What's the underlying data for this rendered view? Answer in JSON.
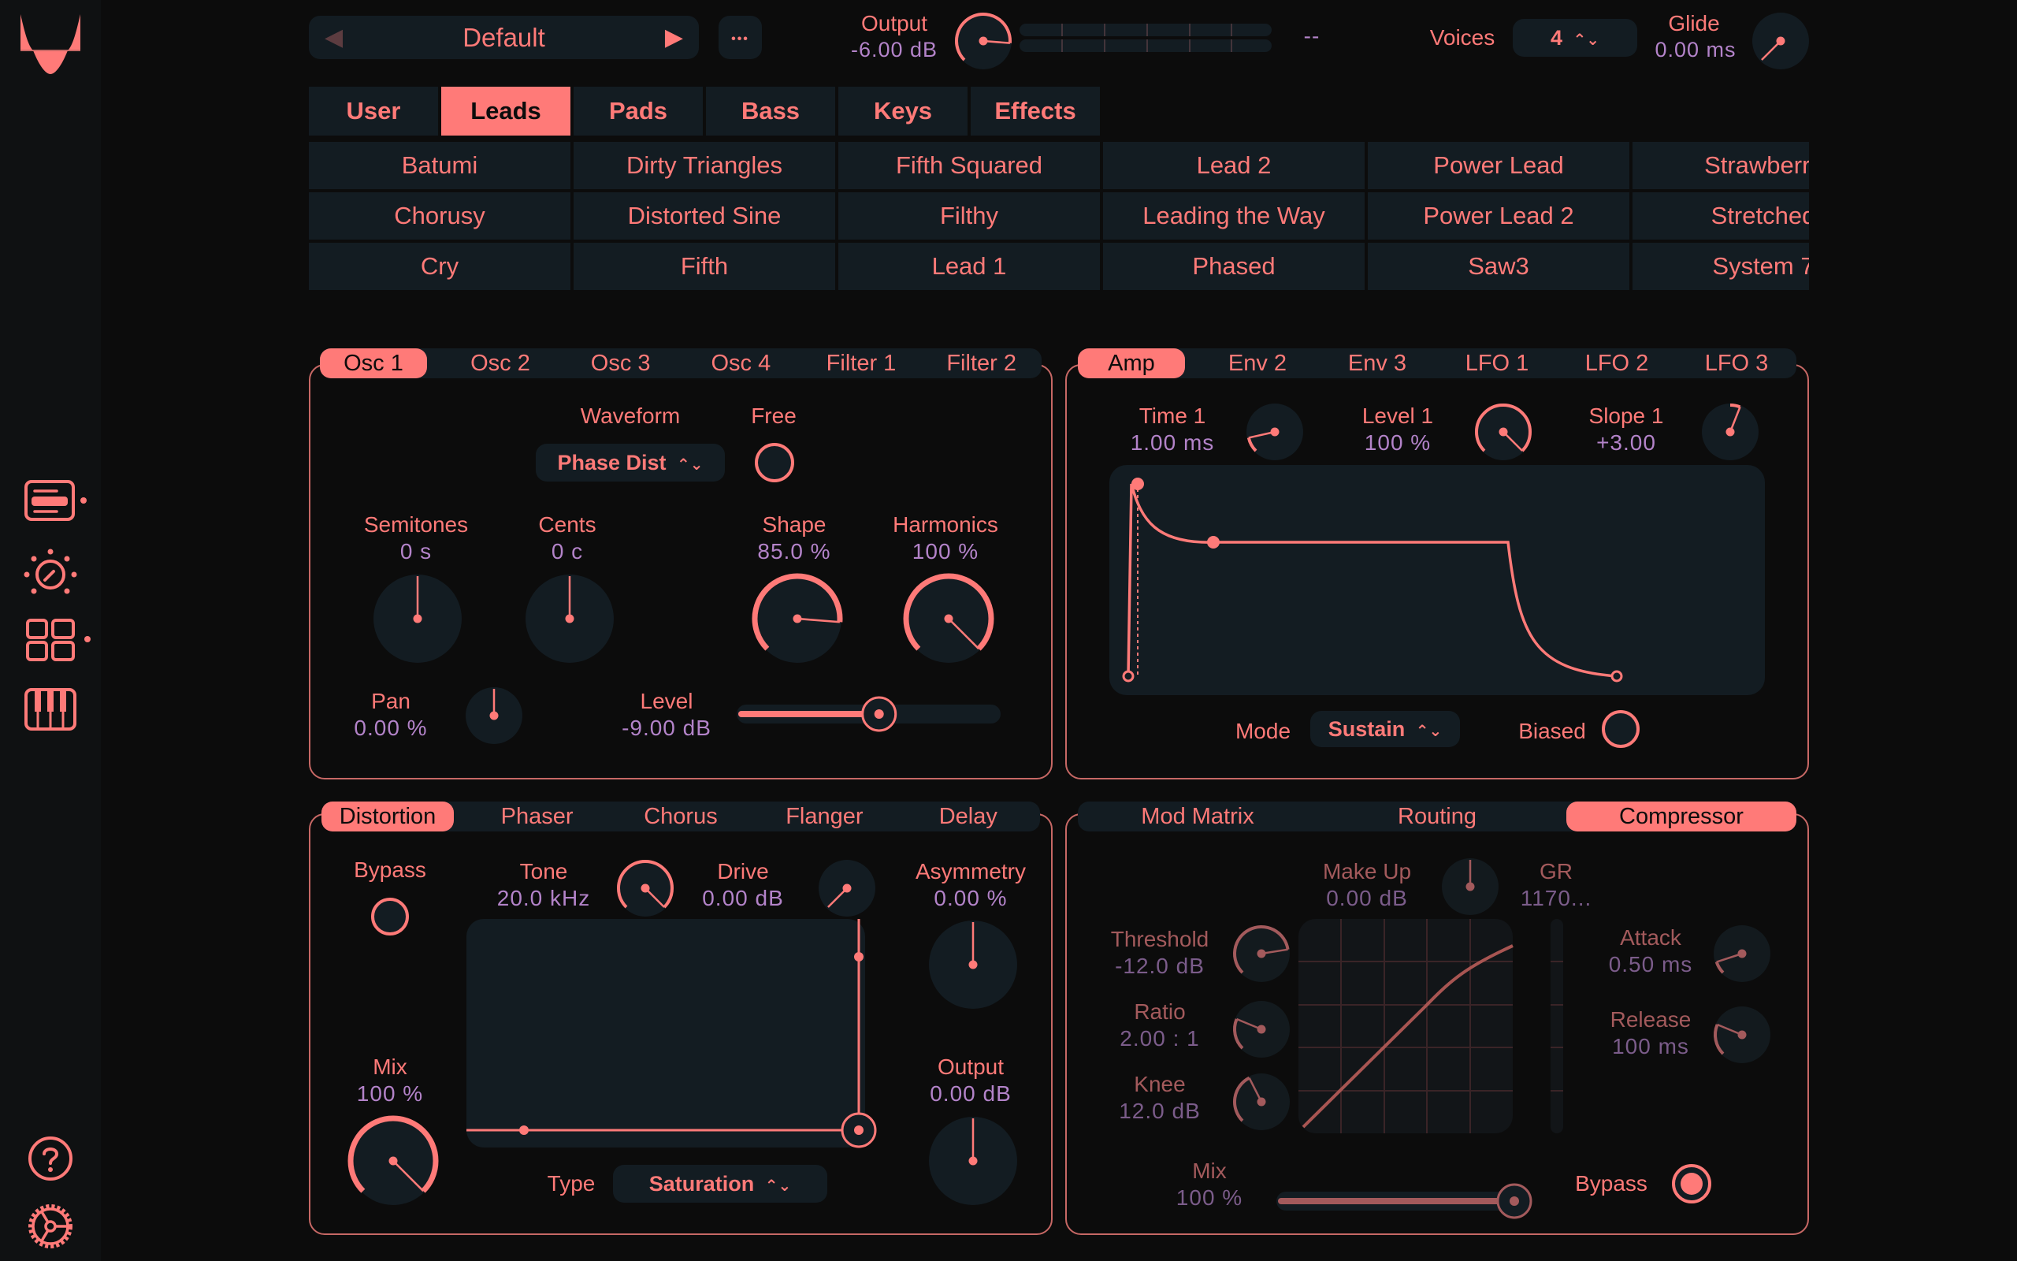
{
  "colors": {
    "accent": "#ff7a78",
    "value": "#b383c9",
    "panel": "#131c22",
    "background": "#0c0c0c",
    "dim_accent": "#a35a5c"
  },
  "sidebar": {
    "logo": "waveform-logo",
    "items": [
      {
        "name": "presets",
        "icon": "preset-browser-icon",
        "has_dot": true
      },
      {
        "name": "controls",
        "icon": "knob-icon",
        "has_dot": false
      },
      {
        "name": "modules",
        "icon": "grid-icon",
        "has_dot": true
      },
      {
        "name": "keyboard",
        "icon": "piano-icon",
        "has_dot": false
      }
    ],
    "bottom": [
      {
        "name": "help",
        "icon": "help-icon"
      },
      {
        "name": "settings",
        "icon": "settings-gear-icon"
      }
    ]
  },
  "header": {
    "preset": "Default",
    "prev_icon": "◀",
    "next_icon": "▶",
    "more_icon": "•••",
    "output": {
      "label": "Output",
      "value": "-6.00 dB",
      "knob_fraction": 0.85
    },
    "meter_readout": "--",
    "voices": {
      "label": "Voices",
      "value": "4"
    },
    "glide": {
      "label": "Glide",
      "value": "0.00 ms",
      "knob_fraction": 0.0
    }
  },
  "categories": {
    "tabs": [
      "User",
      "Leads",
      "Pads",
      "Bass",
      "Keys",
      "Effects"
    ],
    "active": "Leads"
  },
  "presets": {
    "rows": [
      [
        "Batumi",
        "Dirty Triangles",
        "Fifth Squared",
        "Lead 2",
        "Power Lead",
        "Strawberry"
      ],
      [
        "Chorusy",
        "Distorted Sine",
        "Filthy",
        "Leading the Way",
        "Power Lead 2",
        "Stretched"
      ],
      [
        "Cry",
        "Fifth",
        "Lead 1",
        "Phased",
        "Saw3",
        "System 7"
      ]
    ]
  },
  "osc_panel": {
    "tabs": [
      "Osc 1",
      "Osc 2",
      "Osc 3",
      "Osc 4",
      "Filter 1",
      "Filter 2"
    ],
    "active": "Osc 1",
    "waveform": {
      "label": "Waveform",
      "value": "Phase Dist"
    },
    "free": {
      "label": "Free",
      "on": false
    },
    "semitones": {
      "label": "Semitones",
      "value": "0 s",
      "knob_fraction": 0.5
    },
    "cents": {
      "label": "Cents",
      "value": "0 c",
      "knob_fraction": 0.5
    },
    "shape": {
      "label": "Shape",
      "value": "85.0 %",
      "knob_fraction": 0.85
    },
    "harmonics": {
      "label": "Harmonics",
      "value": "100 %",
      "knob_fraction": 1.0
    },
    "pan": {
      "label": "Pan",
      "value": "0.00 %",
      "knob_fraction": 0.5
    },
    "level": {
      "label": "Level",
      "value": "-9.00 dB",
      "slider_fraction": 0.54
    }
  },
  "env_panel": {
    "tabs": [
      "Amp",
      "Env 2",
      "Env 3",
      "LFO 1",
      "LFO 2",
      "LFO 3"
    ],
    "active": "Amp",
    "time1": {
      "label": "Time 1",
      "value": "1.00 ms",
      "knob_fraction": 0.12
    },
    "level1": {
      "label": "Level 1",
      "value": "100 %",
      "knob_fraction": 1.0
    },
    "slope1": {
      "label": "Slope 1",
      "value": "+3.00",
      "knob_fraction": 0.58
    },
    "mode": {
      "label": "Mode",
      "value": "Sustain"
    },
    "biased": {
      "label": "Biased",
      "on": false
    }
  },
  "fx_panel": {
    "tabs": [
      "Distortion",
      "Phaser",
      "Chorus",
      "Flanger",
      "Delay"
    ],
    "active": "Distortion",
    "bypass": {
      "label": "Bypass",
      "on": false
    },
    "tone": {
      "label": "Tone",
      "value": "20.0 kHz",
      "knob_fraction": 1.0
    },
    "drive": {
      "label": "Drive",
      "value": "0.00 dB",
      "knob_fraction": 0.0
    },
    "asymmetry": {
      "label": "Asymmetry",
      "value": "0.00 %",
      "knob_fraction": 0.5
    },
    "mix": {
      "label": "Mix",
      "value": "100 %",
      "knob_fraction": 1.0
    },
    "output": {
      "label": "Output",
      "value": "0.00 dB",
      "knob_fraction": 0.5
    },
    "type": {
      "label": "Type",
      "value": "Saturation"
    }
  },
  "comp_panel": {
    "tabs": [
      "Mod Matrix",
      "Routing",
      "Compressor"
    ],
    "active": "Compressor",
    "makeup": {
      "label": "Make Up",
      "value": "0.00 dB",
      "knob_fraction": 0.5
    },
    "gr": {
      "label": "GR",
      "value": "1170..."
    },
    "threshold": {
      "label": "Threshold",
      "value": "-12.0 dB",
      "knob_fraction": 0.8
    },
    "ratio": {
      "label": "Ratio",
      "value": "2.00 : 1",
      "knob_fraction": 0.25
    },
    "knee": {
      "label": "Knee",
      "value": "12.0 dB",
      "knob_fraction": 0.4
    },
    "attack": {
      "label": "Attack",
      "value": "0.50 ms",
      "knob_fraction": 0.1
    },
    "release": {
      "label": "Release",
      "value": "100 ms",
      "knob_fraction": 0.25
    },
    "mix": {
      "label": "Mix",
      "value": "100 %",
      "slider_fraction": 1.0
    },
    "bypass": {
      "label": "Bypass",
      "on": true
    }
  }
}
